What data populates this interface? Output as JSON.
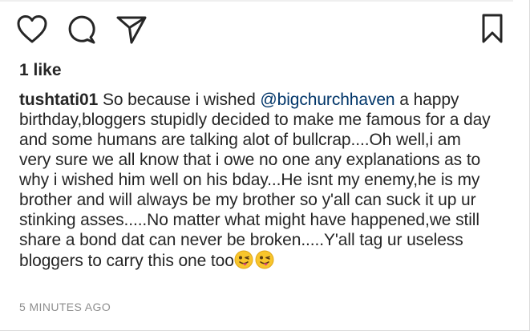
{
  "post": {
    "likes": "1 like",
    "caption": {
      "username": "tushtati01",
      "text_before_mention": "So because i wished",
      "mention": "@bigchurchhaven",
      "text_after_mention": "a happy birthday,bloggers stupidly decided to make me famous for a day and some humans are talking alot of bullcrap....Oh well,i am very sure we all know that i owe no one any explanations as to why i wished him well on his bday...He isnt my enemy,he is my brother and will always be my brother so y'all can suck it up ur stinking asses.....No matter what might have happened,we still share a bond dat can never be broken.....Y'all tag ur useless bloggers to carry this one too",
      "emojis": [
        "winking-face-with-tongue",
        "winking-face-with-tongue"
      ]
    },
    "timestamp": "5 MINUTES AGO"
  },
  "icons": {
    "like": "heart-icon",
    "comment": "comment-icon",
    "share": "paper-plane-icon",
    "save": "bookmark-icon"
  },
  "colors": {
    "text": "#262626",
    "mention": "#003569",
    "muted": "#8e8e8e"
  }
}
